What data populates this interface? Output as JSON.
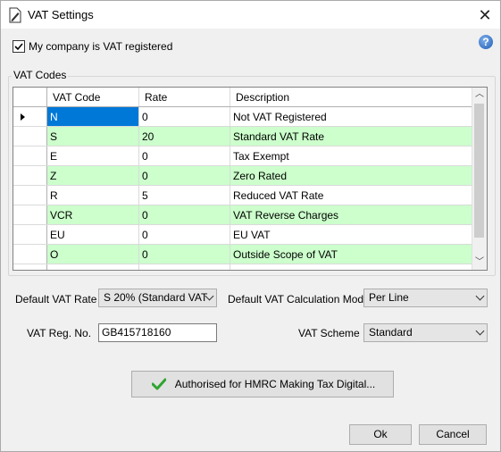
{
  "window": {
    "title": "VAT Settings"
  },
  "vat_registered": {
    "label": "My company is VAT registered",
    "checked": true
  },
  "help_icon": "help-icon",
  "vat_codes": {
    "group_label": "VAT Codes",
    "columns": [
      "VAT Code",
      "Rate",
      "Description"
    ],
    "rows": [
      {
        "code": "N",
        "rate": "0",
        "description": "Not VAT Registered"
      },
      {
        "code": "S",
        "rate": "20",
        "description": "Standard VAT Rate"
      },
      {
        "code": "E",
        "rate": "0",
        "description": "Tax Exempt"
      },
      {
        "code": "Z",
        "rate": "0",
        "description": "Zero Rated"
      },
      {
        "code": "R",
        "rate": "5",
        "description": "Reduced VAT Rate"
      },
      {
        "code": "VCR",
        "rate": "0",
        "description": "VAT Reverse Charges"
      },
      {
        "code": "EU",
        "rate": "0",
        "description": "EU VAT"
      },
      {
        "code": "O",
        "rate": "0",
        "description": "Outside Scope of VAT"
      }
    ]
  },
  "default_vat_rate": {
    "label": "Default VAT Rate",
    "value": "S   20% (Standard VAT"
  },
  "calc_mode": {
    "label": "Default VAT Calculation Mode",
    "value": "Per Line"
  },
  "vat_reg_no": {
    "label": "VAT Reg. No.",
    "value": "GB415718160"
  },
  "vat_scheme": {
    "label": "VAT Scheme",
    "value": "Standard"
  },
  "hmrc_button": {
    "label": "Authorised for HMRC Making Tax Digital..."
  },
  "buttons": {
    "ok": "Ok",
    "cancel": "Cancel"
  },
  "colors": {
    "green_row": "#ccffcc",
    "selection": "#0078d7"
  }
}
